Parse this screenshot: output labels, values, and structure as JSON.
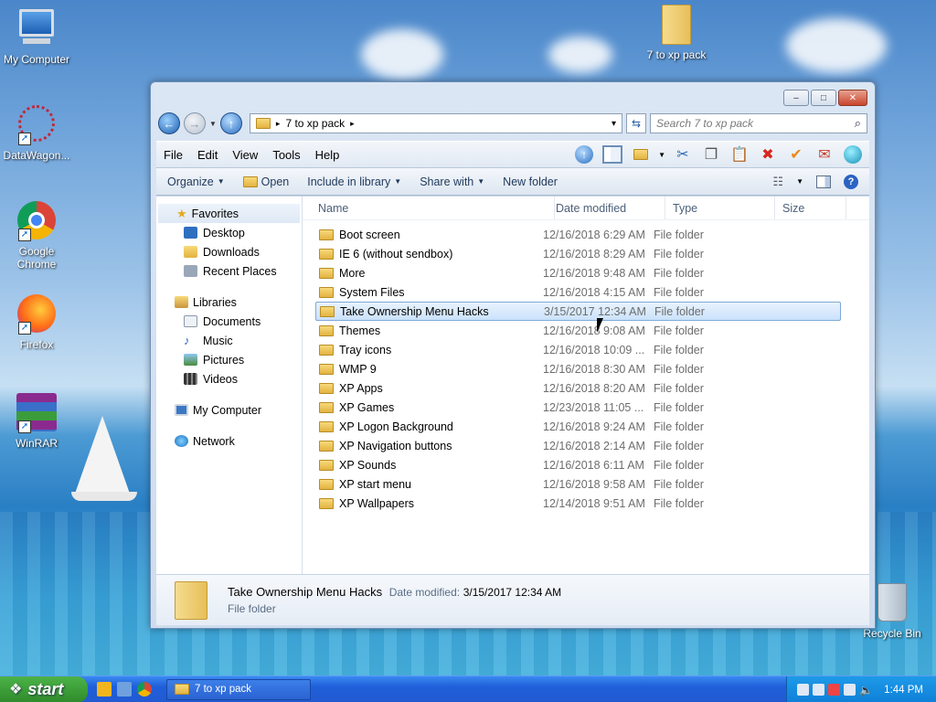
{
  "desktop": {
    "icons": [
      {
        "label": "My Computer",
        "icon": "my-computer-icon"
      },
      {
        "label": "DataWagon...",
        "icon": "datawagon-icon"
      },
      {
        "label": "Google Chrome",
        "icon": "chrome-icon"
      },
      {
        "label": "Firefox",
        "icon": "firefox-icon"
      },
      {
        "label": "WinRAR",
        "icon": "winrar-icon"
      },
      {
        "label": "7 to xp pack",
        "icon": "folder-icon"
      },
      {
        "label": "Recycle Bin",
        "icon": "recycle-bin-icon"
      }
    ]
  },
  "window": {
    "caption_buttons": {
      "minimize": "–",
      "maximize": "□",
      "close": "✕"
    },
    "address": {
      "crumb_sep": "▸",
      "path": "7 to xp pack",
      "dropdown": "▾",
      "refresh": "⇆"
    },
    "search": {
      "placeholder": "Search 7 to xp pack",
      "icon_glyph": "⌕"
    },
    "menu": {
      "file": "File",
      "edit": "Edit",
      "view": "View",
      "tools": "Tools",
      "help": "Help"
    },
    "commands": {
      "organize": "Organize",
      "open": "Open",
      "include_in_library": "Include in library",
      "share_with": "Share with",
      "new_folder": "New folder",
      "dropdown_glyph": "▼",
      "help_glyph": "?"
    },
    "navpane": {
      "favorites": {
        "title": "Favorites",
        "items": [
          "Desktop",
          "Downloads",
          "Recent Places"
        ]
      },
      "libraries": {
        "title": "Libraries",
        "items": [
          "Documents",
          "Music",
          "Pictures",
          "Videos"
        ]
      },
      "computer": "My Computer",
      "network": "Network"
    },
    "columns": {
      "name": "Name",
      "date": "Date modified",
      "type": "Type",
      "size": "Size"
    },
    "rows": [
      {
        "name": "Boot screen",
        "date": "12/16/2018 6:29 AM",
        "type": "File folder"
      },
      {
        "name": "IE 6 (without sendbox)",
        "date": "12/16/2018 8:29 AM",
        "type": "File folder"
      },
      {
        "name": "More",
        "date": "12/16/2018 9:48 AM",
        "type": "File folder"
      },
      {
        "name": "System Files",
        "date": "12/16/2018 4:15 AM",
        "type": "File folder"
      },
      {
        "name": "Take Ownership Menu Hacks",
        "date": "3/15/2017 12:34 AM",
        "type": "File folder"
      },
      {
        "name": "Themes",
        "date": "12/16/2018 9:08 AM",
        "type": "File folder"
      },
      {
        "name": "Tray icons",
        "date": "12/16/2018 10:09 ...",
        "type": "File folder"
      },
      {
        "name": "WMP 9",
        "date": "12/16/2018 8:30 AM",
        "type": "File folder"
      },
      {
        "name": "XP Apps",
        "date": "12/16/2018 8:20 AM",
        "type": "File folder"
      },
      {
        "name": "XP Games",
        "date": "12/23/2018 11:05 ...",
        "type": "File folder"
      },
      {
        "name": "XP Logon Background",
        "date": "12/16/2018 9:24 AM",
        "type": "File folder"
      },
      {
        "name": "XP Navigation buttons",
        "date": "12/16/2018 2:14 AM",
        "type": "File folder"
      },
      {
        "name": "XP Sounds",
        "date": "12/16/2018 6:11 AM",
        "type": "File folder"
      },
      {
        "name": "XP start menu",
        "date": "12/16/2018 9:58 AM",
        "type": "File folder"
      },
      {
        "name": "XP Wallpapers",
        "date": "12/14/2018 9:51 AM",
        "type": "File folder"
      }
    ],
    "details": {
      "name": "Take Ownership Menu Hacks",
      "date_label": "Date modified:",
      "date_value": "3/15/2017 12:34 AM",
      "type": "File folder"
    }
  },
  "taskbar": {
    "start": "start",
    "task": "7 to xp pack",
    "clock": "1:44 PM"
  }
}
